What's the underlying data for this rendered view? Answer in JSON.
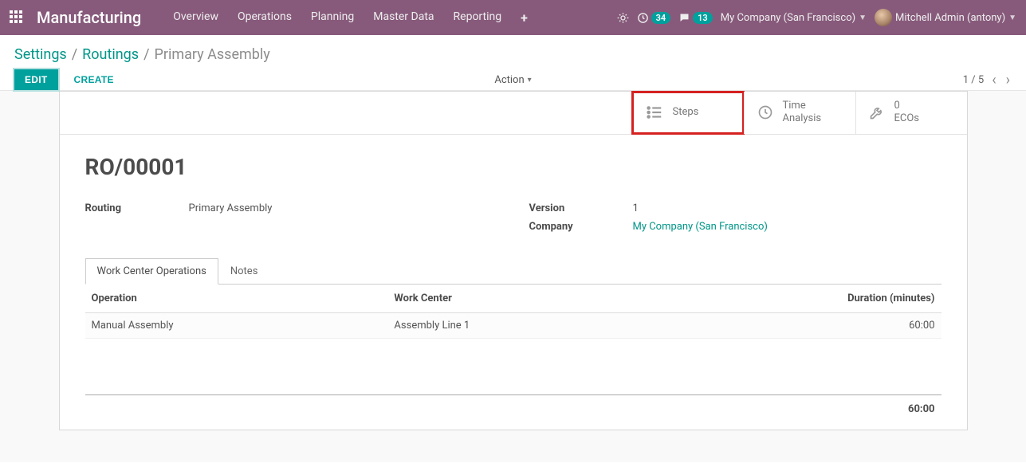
{
  "topbar": {
    "brand": "Manufacturing",
    "nav": [
      "Overview",
      "Operations",
      "Planning",
      "Master Data",
      "Reporting"
    ],
    "clock_badge": "34",
    "chat_badge": "13",
    "company": "My Company (San Francisco)",
    "user": "Mitchell Admin (antony)"
  },
  "breadcrumbs": {
    "items": [
      "Settings",
      "Routings"
    ],
    "current": "Primary Assembly"
  },
  "actions": {
    "edit": "EDIT",
    "create": "CREATE",
    "action_menu": "Action"
  },
  "pager": {
    "text": "1 / 5"
  },
  "stat_buttons": {
    "steps": {
      "label": "Steps"
    },
    "time": {
      "line1": "Time",
      "line2": "Analysis"
    },
    "ecos": {
      "count": "0",
      "label": "ECOs"
    }
  },
  "record": {
    "title": "RO/00001",
    "routing_label": "Routing",
    "routing_value": "Primary Assembly",
    "version_label": "Version",
    "version_value": "1",
    "company_label": "Company",
    "company_value": "My Company (San Francisco)"
  },
  "tabs": {
    "wco": "Work Center Operations",
    "notes": "Notes"
  },
  "grid": {
    "headers": {
      "operation": "Operation",
      "work_center": "Work Center",
      "duration": "Duration (minutes)"
    },
    "rows": [
      {
        "operation": "Manual Assembly",
        "work_center": "Assembly Line 1",
        "duration": "60:00"
      }
    ],
    "total": "60:00"
  }
}
